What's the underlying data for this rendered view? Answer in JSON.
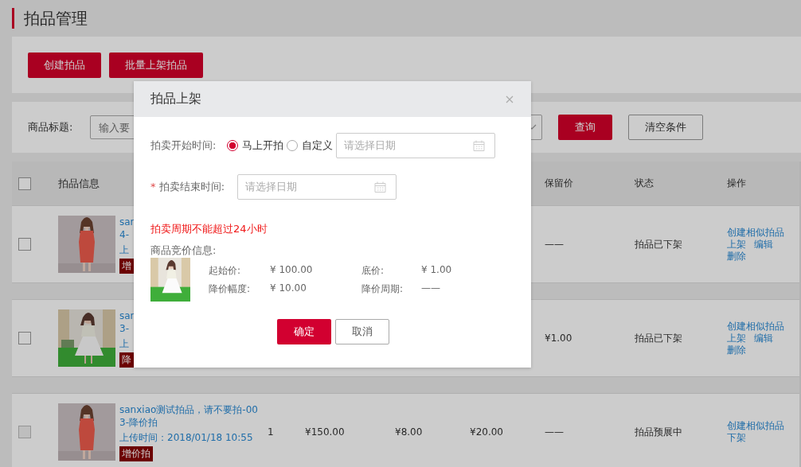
{
  "page_title": "拍品管理",
  "toolbar": {
    "buttons": [
      "创建拍品",
      "批量上架拍品"
    ]
  },
  "filter": {
    "label": "商品标题:",
    "placeholder": "输入要",
    "buttons": [
      {
        "label": "查询",
        "kind": "primary"
      },
      {
        "label": "清空条件",
        "kind": "default"
      }
    ]
  },
  "table": {
    "header": {
      "checked": false,
      "info": "拍品信息",
      "reserve": "保留价",
      "status": "状态",
      "actions": "操作"
    },
    "rows": [
      {
        "checked": false,
        "disabled": false,
        "title_lines": [
          "san",
          "4-"
        ],
        "upload": "上",
        "tag": "增",
        "reserve": "——",
        "status": "拍品已下架",
        "actions": [
          "创建相似拍品",
          "上架",
          "编辑",
          "删除"
        ]
      },
      {
        "checked": false,
        "disabled": false,
        "title_lines": [
          "san",
          "3-"
        ],
        "upload": "上",
        "tag": "降",
        "reserve": "¥1.00",
        "status": "拍品已下架",
        "actions": [
          "创建相似拍品",
          "上架",
          "编辑",
          "删除"
        ]
      },
      {
        "checked": false,
        "disabled": true,
        "title_lines": [
          "sanxiao测试拍品，请不要拍-00",
          "3-降价拍"
        ],
        "upload": "上传时间：2018/01/18 10:55",
        "tag": "增价拍",
        "quantity": "1",
        "start_price": "¥150.00",
        "floor_price": "¥8.00",
        "step_price": "¥20.00",
        "reserve": "——",
        "status": "拍品预展中",
        "actions": [
          "创建相似拍品",
          "下架"
        ]
      }
    ]
  },
  "dialog": {
    "title": "拍品上架",
    "start": {
      "label": "拍卖开始时间:",
      "options": [
        {
          "label": "马上开拍",
          "selected": true
        },
        {
          "label": "自定义",
          "selected": false
        }
      ],
      "placeholder": "请选择日期"
    },
    "end": {
      "marker": "*",
      "label": "拍卖结束时间:",
      "placeholder": "请选择日期"
    },
    "error": "拍卖周期不能超过24小时",
    "info_label": "商品竞价信息:",
    "info": [
      {
        "label": "起始价:",
        "value": "¥ 100.00"
      },
      {
        "label": "底价:",
        "value": "¥ 1.00"
      },
      {
        "label": "降价幅度:",
        "value": "¥ 10.00"
      },
      {
        "label": "降价周期:",
        "value": "——"
      }
    ],
    "buttons": [
      {
        "label": "确定",
        "kind": "primary"
      },
      {
        "label": "取消",
        "kind": "default"
      }
    ]
  }
}
